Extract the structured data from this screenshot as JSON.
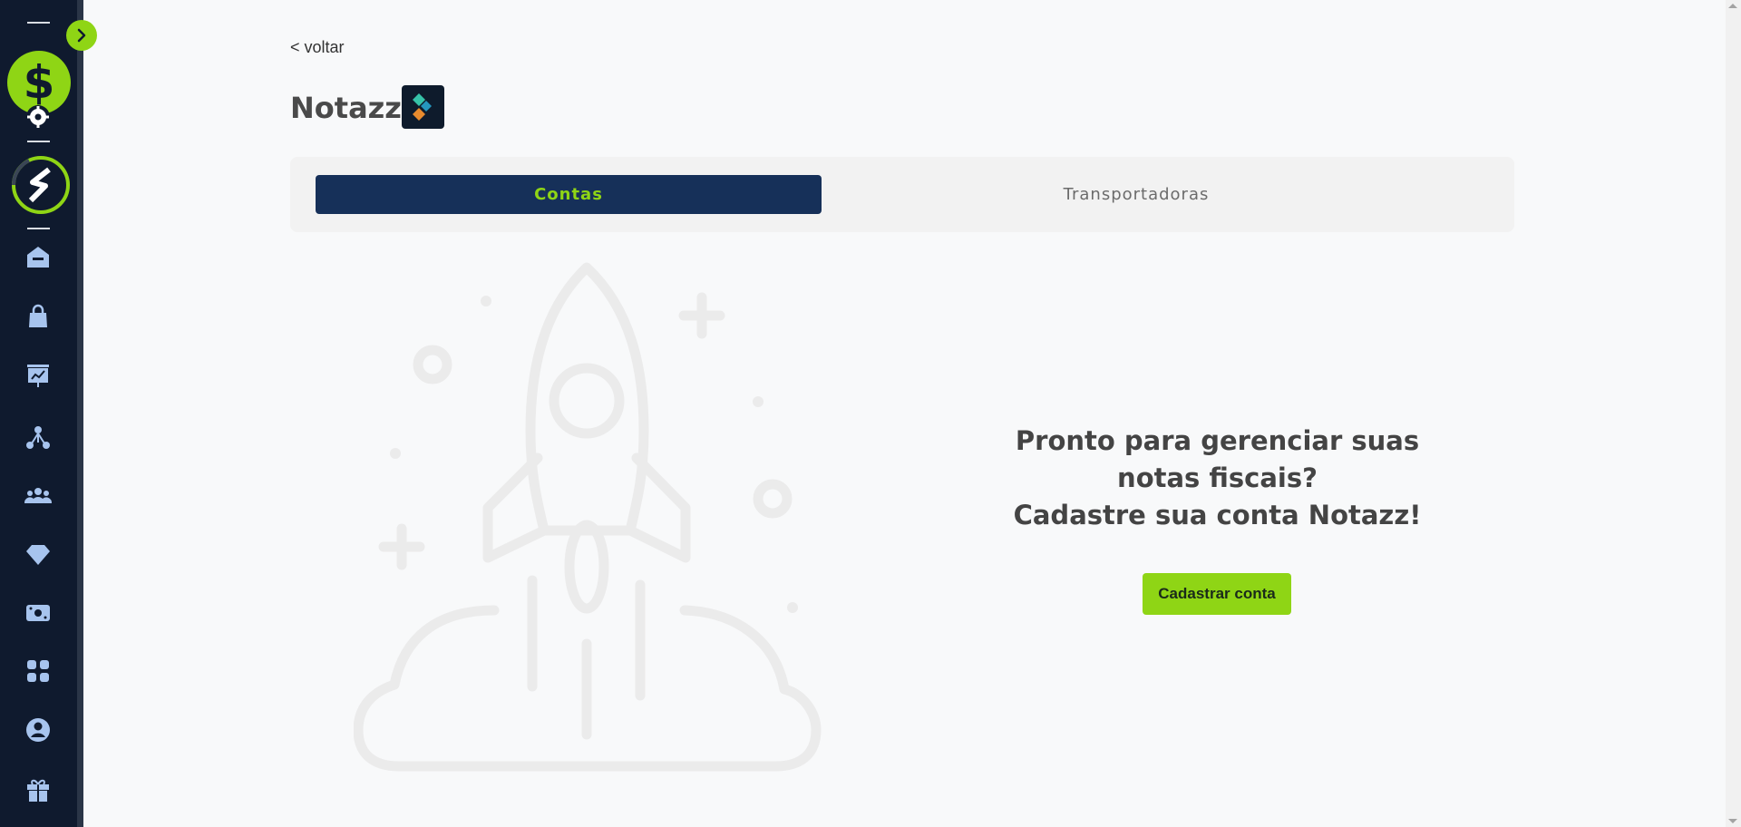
{
  "navigation": {
    "back_label": "< voltar"
  },
  "page": {
    "title": "Notazz"
  },
  "tabs": [
    {
      "label": "Contas",
      "active": true
    },
    {
      "label": "Transportadoras",
      "active": false
    }
  ],
  "empty_state": {
    "heading_lines": [
      "Pronto para gerenciar suas",
      "notas fiscais?",
      "Cadastre sua conta Notazz!"
    ],
    "button_label": "Cadastrar conta"
  },
  "sidebar": {
    "items": [
      {
        "icon": "home-icon"
      },
      {
        "icon": "shopping-bag-icon"
      },
      {
        "icon": "presentation-chart-icon"
      },
      {
        "icon": "network-icon"
      },
      {
        "icon": "users-icon"
      },
      {
        "icon": "diamond-icon"
      },
      {
        "icon": "money-icon"
      },
      {
        "icon": "apps-icon"
      },
      {
        "icon": "user-circle-icon"
      },
      {
        "icon": "gift-icon"
      }
    ]
  },
  "colors": {
    "accent": "#8fd515",
    "sidebar_bg": "#0f1a2e",
    "tab_active_bg": "#163059",
    "icon_color": "#a7c4ee"
  }
}
